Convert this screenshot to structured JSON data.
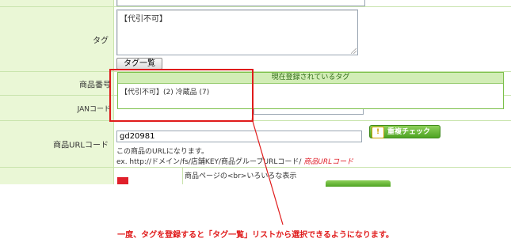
{
  "form": {
    "tag_row": {
      "label": "タグ",
      "textarea_value": "【代引不可】",
      "list_button": "タグ一覧"
    },
    "product_no_row": {
      "label": "商品番号"
    },
    "jan_row": {
      "label": "JANコード"
    },
    "url_row": {
      "label": "商品URLコード",
      "value": "gd20981",
      "check_button": "重複チェック",
      "help_line1": "この商品のURLになります。",
      "help_line2": "ex. http://ドメイン/fs/店舗KEY/商品グループURLコード/ ",
      "help_line2_em": "商品URLコード"
    },
    "next_row": {
      "hint": "商品ページの<br>いろいろな表示"
    }
  },
  "tag_popup": {
    "title": "現在登録されているタグ",
    "content": "【代引不可】(2)  冷蔵品 (7)"
  },
  "caption": "一度、タグを登録すると「タグ一覧」リストから選択できるようになります。",
  "colors": {
    "label_bg": "#eaf7d6",
    "accent_green": "#4ea323",
    "highlight_red": "#e01b1b"
  }
}
